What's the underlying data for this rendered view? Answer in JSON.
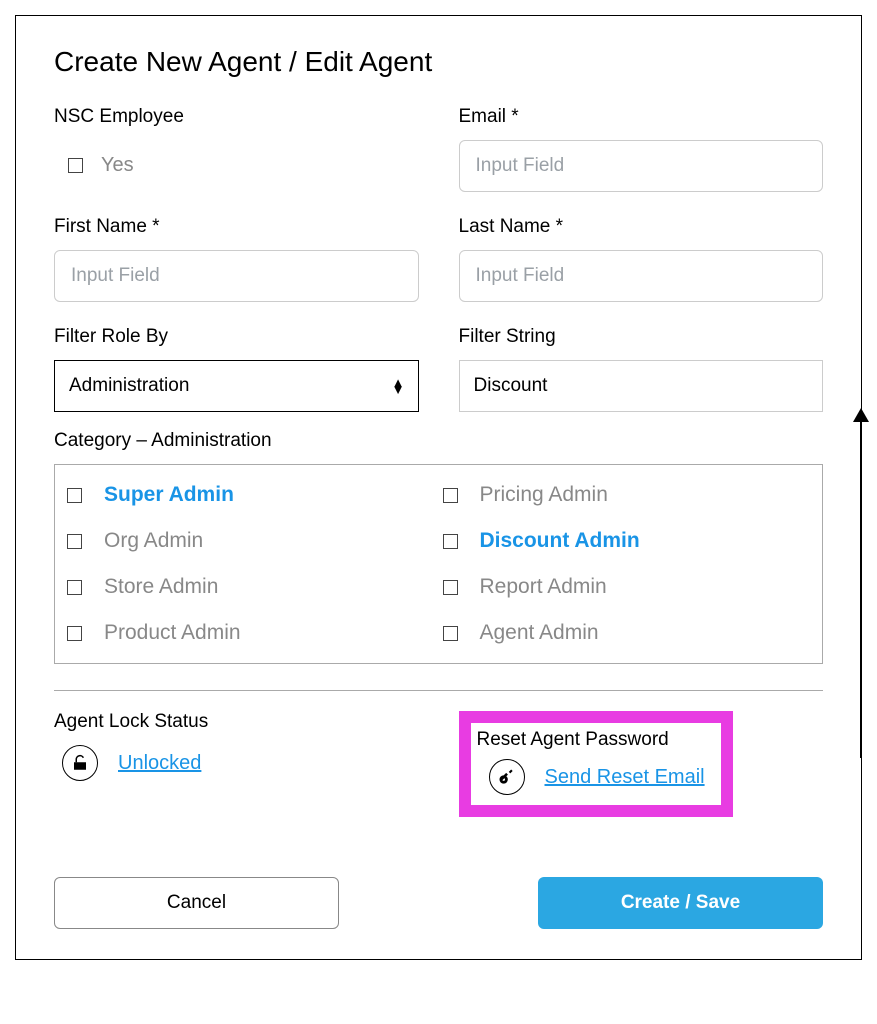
{
  "title": "Create New Agent / Edit Agent",
  "nsc_employee": {
    "label": "NSC Employee",
    "option": "Yes"
  },
  "email": {
    "label": "Email *",
    "placeholder": "Input Field"
  },
  "first_name": {
    "label": "First Name *",
    "placeholder": "Input Field"
  },
  "last_name": {
    "label": "Last Name *",
    "placeholder": "Input Field"
  },
  "filter_role": {
    "label": "Filter Role By",
    "value": "Administration"
  },
  "filter_string": {
    "label": "Filter String",
    "value": "Discount"
  },
  "category": {
    "heading": "Category – Administration",
    "roles": [
      {
        "label": "Super Admin",
        "active": true
      },
      {
        "label": "Pricing Admin",
        "active": false
      },
      {
        "label": "Org Admin",
        "active": false
      },
      {
        "label": "Discount Admin",
        "active": true
      },
      {
        "label": "Store Admin",
        "active": false
      },
      {
        "label": "Report Admin",
        "active": false
      },
      {
        "label": "Product Admin",
        "active": false
      },
      {
        "label": "Agent Admin",
        "active": false
      }
    ]
  },
  "lock_status": {
    "label": "Agent Lock Status",
    "link": "Unlocked"
  },
  "reset_password": {
    "label": "Reset Agent Password",
    "link": "Send Reset Email"
  },
  "buttons": {
    "cancel": "Cancel",
    "save": "Create / Save"
  }
}
